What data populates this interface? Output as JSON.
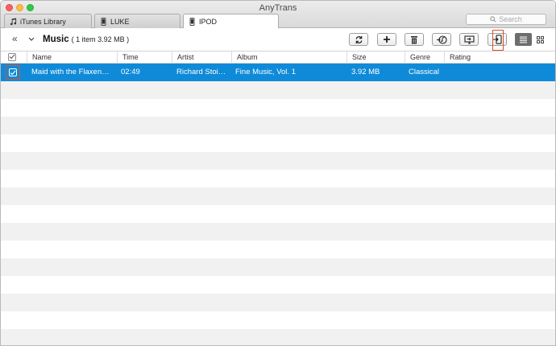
{
  "window": {
    "title": "AnyTrans"
  },
  "tabs": [
    {
      "label": "iTunes Library",
      "icon": "music-note-icon"
    },
    {
      "label": "LUKE",
      "icon": "phone-icon"
    },
    {
      "label": "IPOD",
      "icon": "phone-icon",
      "active": true
    }
  ],
  "search": {
    "placeholder": "Search"
  },
  "breadcrumb": {
    "title": "Music",
    "count": "( 1 item  3.92 MB )"
  },
  "toolbar": {
    "buttons": [
      "refresh-icon",
      "add-icon",
      "delete-icon",
      "to-itunes-icon",
      "to-computer-icon",
      "to-device-icon"
    ],
    "view_modes": [
      "list-view-icon",
      "grid-view-icon"
    ],
    "active_view": "list"
  },
  "table": {
    "columns": [
      "Name",
      "Time",
      "Artist",
      "Album",
      "Size",
      "Genre",
      "Rating"
    ],
    "rows": [
      {
        "name": "Maid with the Flaxen…",
        "time": "02:49",
        "artist": "Richard Stoi…",
        "album": "Fine Music, Vol. 1",
        "size": "3.92 MB",
        "genre": "Classical",
        "rating": "",
        "selected": true,
        "checked": true
      }
    ]
  },
  "colors": {
    "selection": "#0f8ad8",
    "highlight": "#d9512c",
    "stripe": "#f1f1f1"
  }
}
